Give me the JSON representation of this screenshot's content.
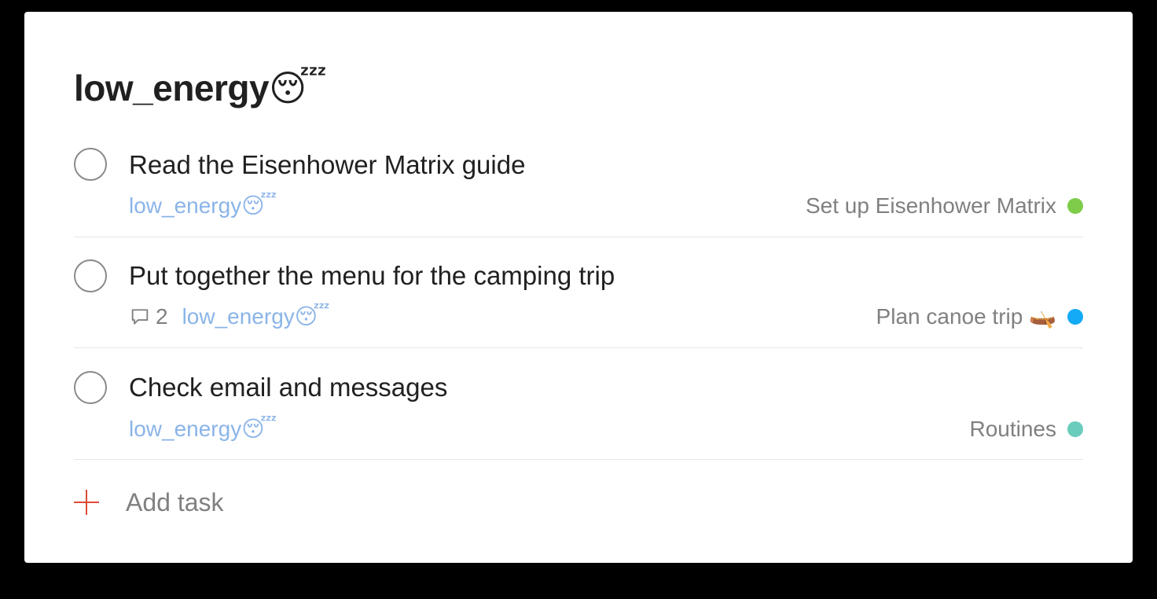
{
  "project": {
    "title": "low_energy",
    "title_emoji": "😴"
  },
  "tasks": [
    {
      "name": "Read the Eisenhower Matrix guide",
      "comment_count": "",
      "label": "low_energy",
      "label_emoji": "😴",
      "project": "Set up Eisenhower Matrix",
      "project_emoji": "",
      "project_color": "#7ecc49"
    },
    {
      "name": "Put together the menu for the camping trip",
      "comment_count": "2",
      "label": "low_energy",
      "label_emoji": "😴",
      "project": "Plan canoe trip",
      "project_emoji": "🛶",
      "project_color": "#14aaf5"
    },
    {
      "name": "Check email and messages",
      "comment_count": "",
      "label": "low_energy",
      "label_emoji": "😴",
      "project": "Routines",
      "project_emoji": "",
      "project_color": "#6accbc"
    }
  ],
  "add_task": {
    "label": "Add task",
    "accent_color": "#dd4b39"
  }
}
